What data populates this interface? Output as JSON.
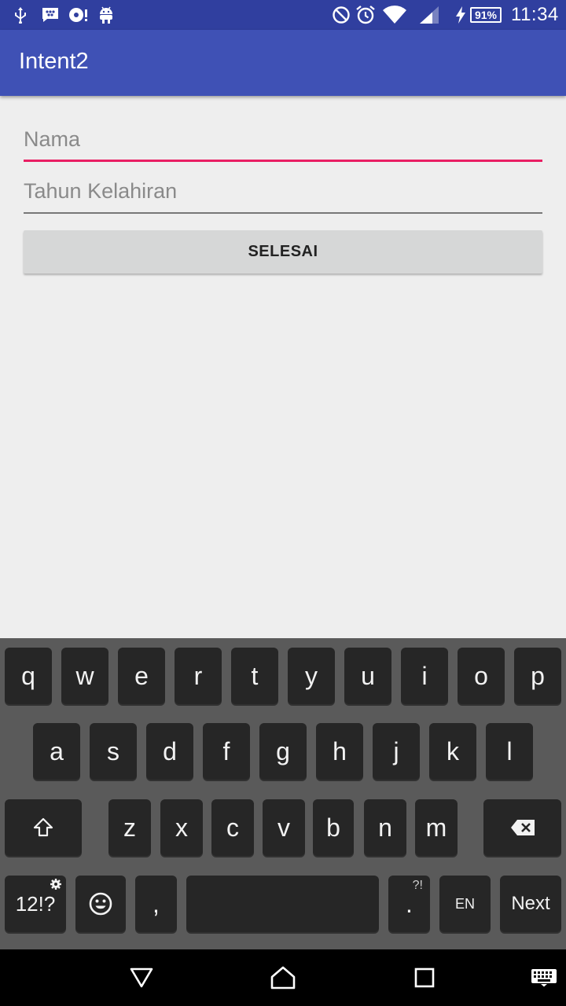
{
  "status_bar": {
    "battery": "91%",
    "time": "11:34"
  },
  "app_bar": {
    "title": "Intent2"
  },
  "form": {
    "nama_placeholder": "Nama",
    "tahun_placeholder": "Tahun Kelahiran",
    "submit_label": "SELESAI"
  },
  "keyboard": {
    "row1": [
      "q",
      "w",
      "e",
      "r",
      "t",
      "y",
      "u",
      "i",
      "o",
      "p"
    ],
    "row2": [
      "a",
      "s",
      "d",
      "f",
      "g",
      "h",
      "j",
      "k",
      "l"
    ],
    "row3": [
      "z",
      "x",
      "c",
      "v",
      "b",
      "n",
      "m"
    ],
    "symbols_label": "12!?",
    "comma_label": ",",
    "period_label": ".",
    "period_corner": "?!",
    "language_label": "EN",
    "action_label": "Next"
  },
  "colors": {
    "status_bar": "#303f9f",
    "app_bar": "#3f51b5",
    "accent": "#e91e63"
  },
  "icons": [
    "usb-icon",
    "bbm-icon",
    "media-icon",
    "android-debug-icon",
    "do-not-disturb-icon",
    "alarm-icon",
    "wifi-icon",
    "cell-signal-icon",
    "charging-icon",
    "back-icon",
    "home-icon",
    "recents-icon",
    "keyboard-switch-icon"
  ]
}
